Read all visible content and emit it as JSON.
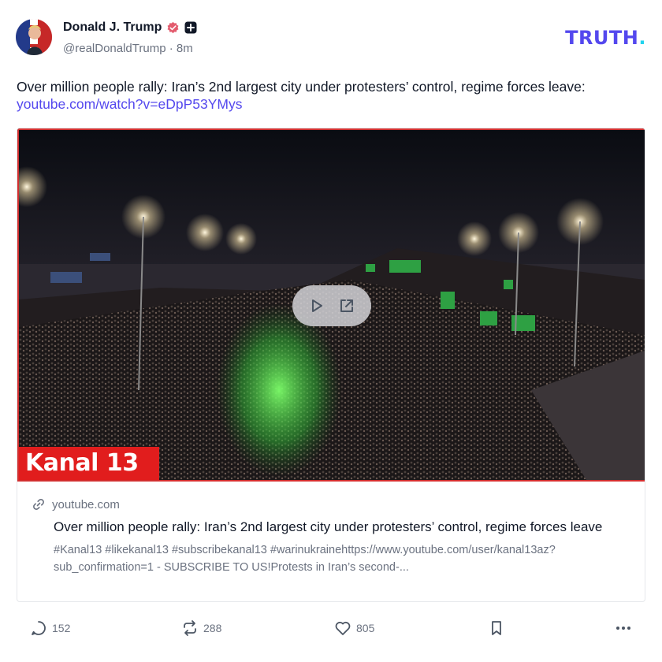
{
  "author": {
    "display_name": "Donald J. Trump",
    "handle": "@realDonaldTrump",
    "timestamp": "8m",
    "verified_icon": "verified-badge-icon",
    "extra_icon": "plus-badge-icon"
  },
  "brand": {
    "logo_text": "TRUTH",
    "logo_dot": ".",
    "accent": "#5448ee",
    "dot_color": "#22d3ee"
  },
  "post": {
    "text": "Over million people rally: Iran’s 2nd largest city under protesters’ control, regime forces leave:",
    "link": "youtube.com/watch?v=eDpP53YMys"
  },
  "link_card": {
    "video_overlay_label": "Kanal 13",
    "play_icon": "play-icon",
    "open_external_icon": "external-link-icon",
    "domain": "youtube.com",
    "title": "Over million people rally: Iran’s 2nd largest city under protesters’ control, regime forces leave",
    "description": "#Kanal13 #likekanal13 #subscribekanal13 #warinukrainehttps://www.youtube.com/user/kanal13az?sub_confirmation=1 - SUBSCRIBE TO US!Protests in Iran’s second-..."
  },
  "actions": {
    "replies": "152",
    "retruths": "288",
    "likes": "805",
    "bookmark_icon": "bookmark-icon",
    "more_icon": "more-icon"
  }
}
